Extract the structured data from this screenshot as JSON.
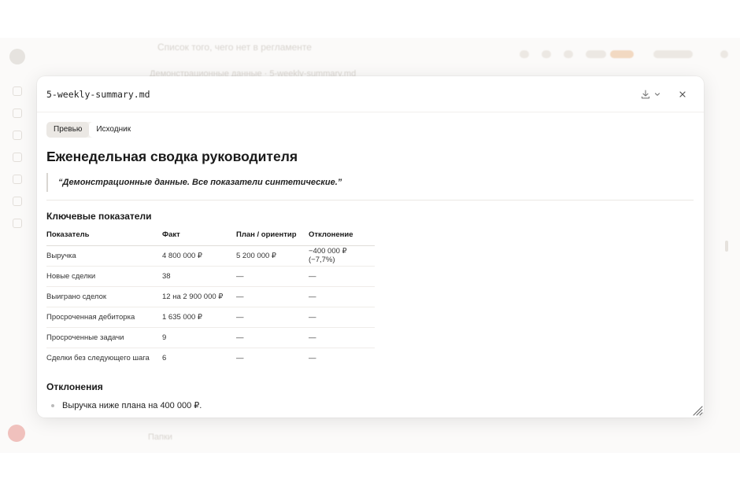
{
  "background": {
    "title": "Список того, чего нет в регламенте",
    "breadcrumb": "Демонстрационные данные · 5-weekly-summary.md",
    "footer": "Папки"
  },
  "modal": {
    "filename": "5-weekly-summary.md",
    "icons": {
      "download": "download-icon",
      "chevron": "chevron-down-icon",
      "close": "close-icon"
    },
    "tabs": [
      {
        "label": "Превью",
        "active": true
      },
      {
        "label": "Исходник",
        "active": false
      }
    ]
  },
  "document": {
    "title": "Еженедельная сводка руководителя",
    "quote": "“Демонстрационные данные. Все показатели синтетические.”",
    "kpi_heading": "Ключевые показатели",
    "table": {
      "headers": [
        "Показатель",
        "Факт",
        "План / ориентир",
        "Отклонение"
      ],
      "rows": [
        [
          "Выручка",
          "4 800 000 ₽",
          "5 200 000 ₽",
          "−400 000 ₽ (−7,7%)"
        ],
        [
          "Новые сделки",
          "38",
          "—",
          "—"
        ],
        [
          "Выиграно сделок",
          "12 на 2 900 000 ₽",
          "—",
          "—"
        ],
        [
          "Просроченная дебиторка",
          "1 635 000 ₽",
          "—",
          "—"
        ],
        [
          "Просроченные задачи",
          "9",
          "—",
          "—"
        ],
        [
          "Сделки без следующего шага",
          "6",
          "—",
          "—"
        ]
      ]
    },
    "deviations_heading": "Отклонения",
    "deviations": [
      "Выручка ниже плана на 400 000 ₽."
    ]
  }
}
